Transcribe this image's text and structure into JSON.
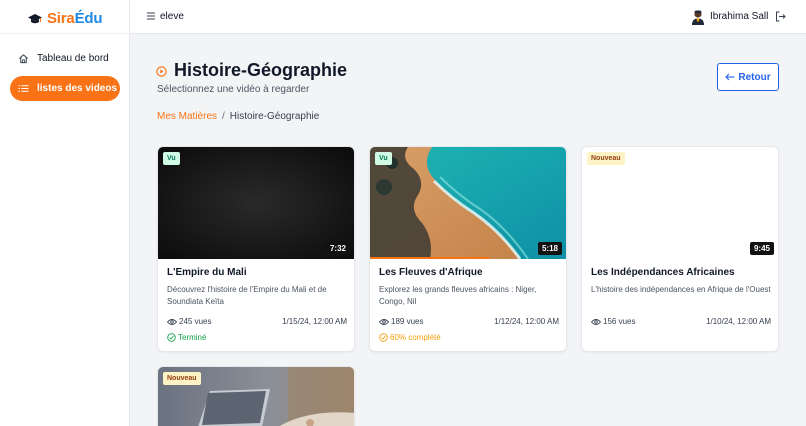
{
  "brand": {
    "name_part1": "Sira",
    "name_part2": "Édu"
  },
  "sidebar": {
    "items": [
      {
        "label": "Tableau de bord",
        "icon": "home-icon",
        "active": false
      },
      {
        "label": "listes des videos",
        "icon": "list-icon",
        "active": true
      }
    ]
  },
  "topbar": {
    "title": "eleve",
    "user_name": "Ibrahima Sall"
  },
  "page": {
    "title": "Histoire-Géographie",
    "subtitle": "Sélectionnez une vidéo à regarder",
    "back_label": "Retour"
  },
  "breadcrumb": {
    "link": "Mes Matières",
    "separator": "/",
    "current": "Histoire-Géographie"
  },
  "videos": [
    {
      "badge": "Vu",
      "duration": "7:32",
      "title": "L'Empire du Mali",
      "description": "Découvrez l'histoire de l'Empire du Mali et de Soundiata Keïta",
      "views": "245 vues",
      "date": "1/15/24, 12:00 AM",
      "status": "Terminé"
    },
    {
      "badge": "Vu",
      "duration": "5:18",
      "title": "Les Fleuves d'Afrique",
      "description": "Explorez les grands fleuves africains : Niger, Congo, Nil",
      "views": "189 vues",
      "date": "1/12/24, 12:00 AM",
      "status": "60% complété",
      "progress": 0.6
    },
    {
      "badge": "Nouveau",
      "duration": "9:45",
      "title": "Les Indépendances Africaines",
      "description": "L'histoire des indépendances en Afrique de l'Ouest",
      "views": "156 vues",
      "date": "1/10/24, 12:00 AM",
      "status": ""
    },
    {
      "badge": "Nouveau"
    }
  ],
  "colors": {
    "accent": "#f97316",
    "primary": "#2563eb",
    "done": "#16a34a",
    "in_progress": "#f59e0b"
  }
}
